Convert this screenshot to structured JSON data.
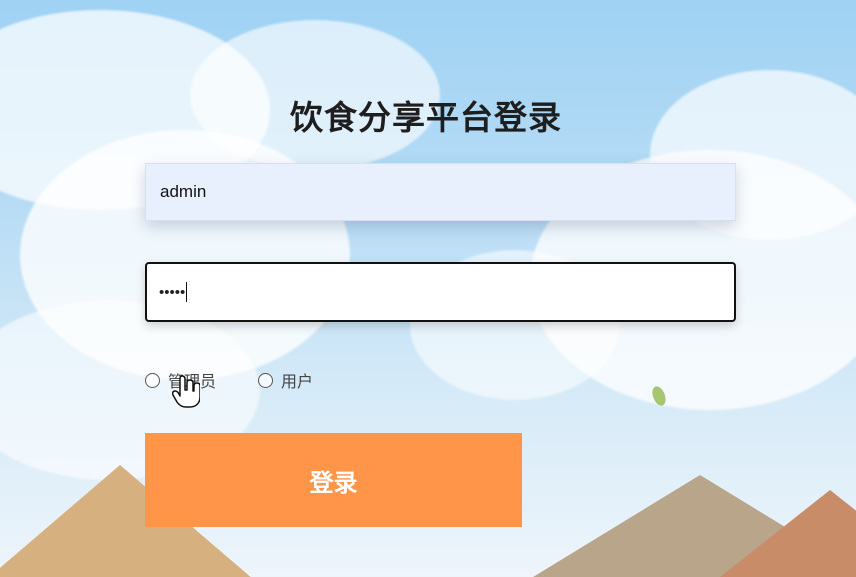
{
  "page": {
    "title": "饮食分享平台登录"
  },
  "form": {
    "username": "admin",
    "password_masked": "•••••"
  },
  "roles": {
    "options": [
      {
        "label": "管理员",
        "selected": false
      },
      {
        "label": "用户",
        "selected": false
      }
    ]
  },
  "actions": {
    "login_label": "登录"
  },
  "colors": {
    "button": "#ff9549",
    "sky": "#9fd2f4",
    "username_background": "#e8f0fe"
  },
  "icons": {
    "pointer": "hand-pointer-icon"
  }
}
